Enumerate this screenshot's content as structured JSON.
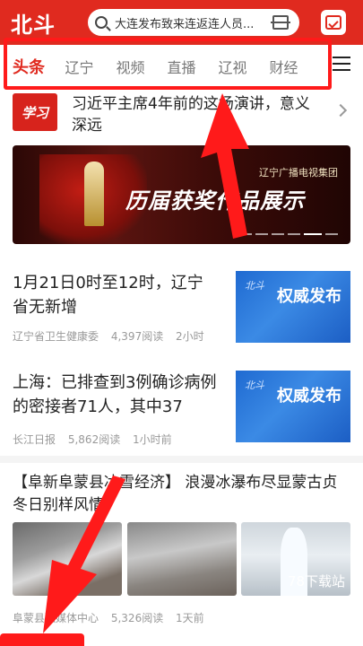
{
  "header": {
    "logo": "北斗",
    "search_text": "大连发布致来连返连人员..."
  },
  "tabs": [
    "头条",
    "辽宁",
    "视频",
    "直播",
    "辽视",
    "财经"
  ],
  "promo": {
    "logo_text": "学习",
    "title": "习近平主席4年前的这场演讲，意义深远"
  },
  "banner": {
    "org": "辽宁广播电视集团",
    "title": "历届获奖作品展示"
  },
  "news": [
    {
      "title": "1月21日0时至12时，辽宁省无新增",
      "source": "辽宁省卫生健康委",
      "reads": "4,397阅读",
      "time": "2小时",
      "thumb_brand": "北斗",
      "thumb_seal": "权威发布"
    },
    {
      "title": "上海：已排查到3例确诊病例的密接者71人，其中37",
      "source": "长江日报",
      "reads": "5,862阅读",
      "time": "1小时前",
      "thumb_brand": "北斗",
      "thumb_seal": "权威发布"
    }
  ],
  "long_news": {
    "title": "【阜新阜蒙县冰雪经济】 浪漫冰瀑布尽显蒙古贞冬日别样风情",
    "watermark": "78下载站",
    "source": "阜蒙县融媒体中心",
    "reads": "5,326阅读",
    "time": "1天前"
  },
  "colors": {
    "brand_red": "#e02a1f",
    "annotation_red": "#ff1a1a",
    "thumb_blue": "#1f6ad1"
  }
}
